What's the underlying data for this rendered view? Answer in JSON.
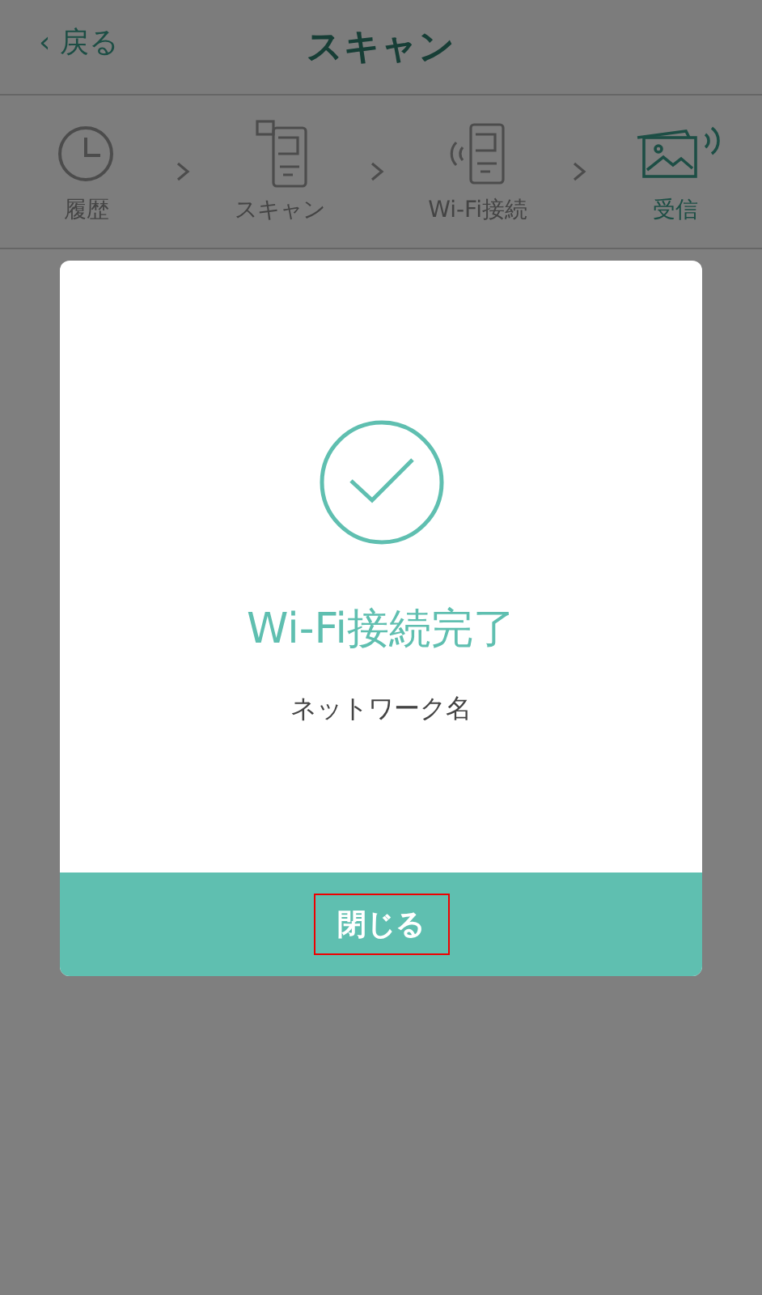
{
  "header": {
    "back": "‹ 戻る",
    "title": "スキャン"
  },
  "steps": [
    {
      "kind": "history",
      "label": "履歴",
      "selected": false
    },
    {
      "kind": "scan",
      "label": "スキャン",
      "selected": false
    },
    {
      "kind": "wifi",
      "label": "Wi-Fi接続",
      "selected": false
    },
    {
      "kind": "receive",
      "label": "受信",
      "selected": true
    }
  ],
  "dialog": {
    "title": "Wi-Fi接続完了",
    "network": "ネットワーク名",
    "button": {
      "label": "閉じる",
      "highlighted": true
    }
  }
}
